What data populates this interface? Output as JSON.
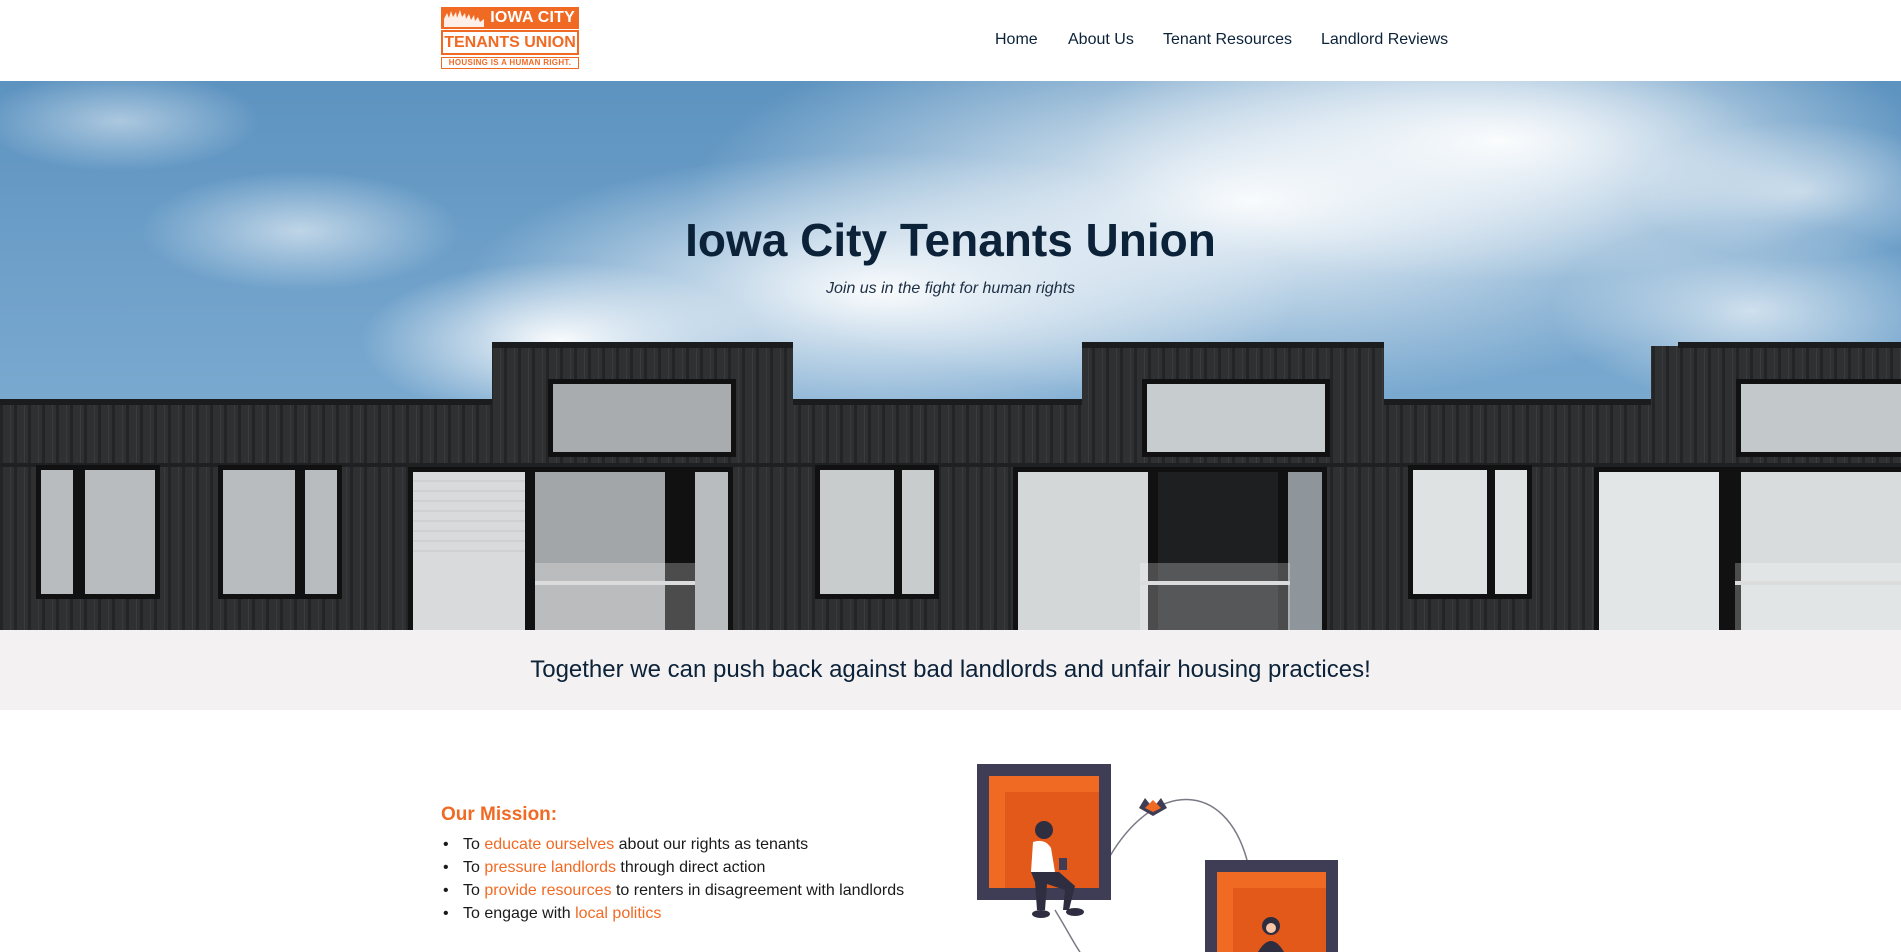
{
  "header": {
    "logo": {
      "line1": "IOWA CITY",
      "line2": "TENANTS UNION",
      "line3": "HOUSING IS A HUMAN RIGHT."
    },
    "nav": [
      {
        "label": "Home"
      },
      {
        "label": "About Us"
      },
      {
        "label": "Tenant Resources"
      },
      {
        "label": "Landlord Reviews"
      }
    ]
  },
  "hero": {
    "title": "Iowa City Tenants Union",
    "subtitle": "Join us in the fight for human rights"
  },
  "banner": {
    "text": "Together we can push back against bad landlords and unfair housing practices!"
  },
  "mission": {
    "heading": "Our Mission:",
    "items": [
      {
        "prefix": "To ",
        "link": "educate ourselves",
        "suffix": " about our rights as tenants"
      },
      {
        "prefix": "To ",
        "link": "pressure landlords",
        "suffix": " through direct action"
      },
      {
        "prefix": "To ",
        "link": "provide resources",
        "suffix": " to renters in disagreement with landlords"
      },
      {
        "prefix": "To engage with ",
        "link": "local politics",
        "suffix": ""
      }
    ]
  },
  "colors": {
    "accent": "#f06a24",
    "navy": "#0b2239",
    "banner_bg": "#f3f1f1"
  }
}
